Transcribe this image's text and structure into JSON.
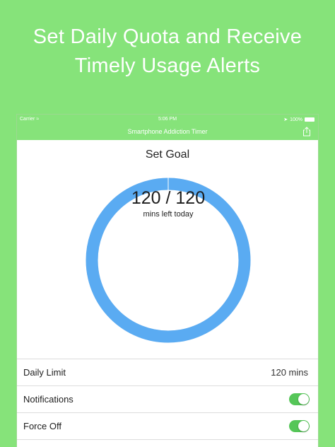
{
  "headline": {
    "line1": "Set Daily Quota and Receive",
    "line2": "Timely Usage Alerts"
  },
  "status_bar": {
    "carrier": "Carrier",
    "time": "5:06 PM",
    "battery": "100%"
  },
  "nav": {
    "title": "Smartphone Addiction Timer",
    "share_icon": "share-icon"
  },
  "goal": {
    "title": "Set Goal",
    "count": "120 / 120",
    "subtitle": "mins left today",
    "remaining_fraction": 1.0,
    "ring_color": "#5aabf2"
  },
  "settings": {
    "daily_limit_label": "Daily Limit",
    "daily_limit_value": "120 mins",
    "notifications_label": "Notifications",
    "notifications_on": true,
    "force_off_label": "Force Off",
    "force_off_on": true
  },
  "colors": {
    "background": "#86e37a",
    "toggle_on": "#55c658"
  }
}
